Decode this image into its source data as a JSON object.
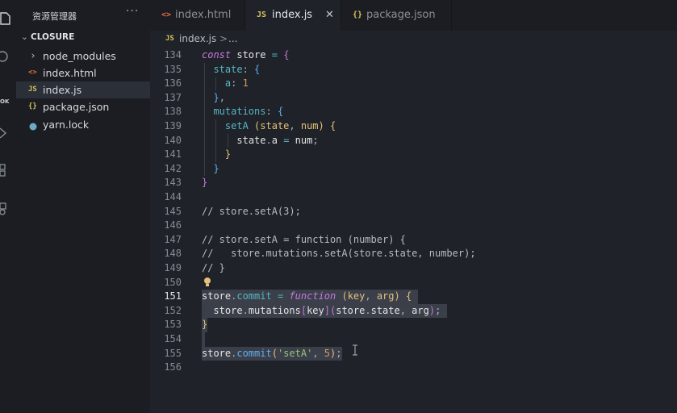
{
  "sidebar": {
    "title": "资源管理器",
    "more_label": "···",
    "root_label": "CLOSURE",
    "items": [
      {
        "label": "node_modules",
        "icon": "folder-chevron-icon",
        "active": false
      },
      {
        "label": "index.html",
        "icon": "html-file-icon",
        "active": false
      },
      {
        "label": "index.js",
        "icon": "js-file-icon",
        "active": true
      },
      {
        "label": "package.json",
        "icon": "json-file-icon",
        "active": false
      },
      {
        "label": "yarn.lock",
        "icon": "yarn-file-icon",
        "active": false
      }
    ],
    "activity_badge": "OK"
  },
  "tabs": [
    {
      "label": "index.html",
      "icon": "html-file-icon",
      "active": false
    },
    {
      "label": "index.js",
      "icon": "js-file-icon",
      "active": true,
      "close": "✕"
    },
    {
      "label": "package.json",
      "icon": "json-file-icon",
      "active": false
    }
  ],
  "breadcrumb": {
    "file_icon": "JS",
    "file": "index.js",
    "separator": ">",
    "rest": "..."
  },
  "icon_glyphs": {
    "html": "<>",
    "js": "JS",
    "json": "{}",
    "chevron": "⌄",
    "chevron_right": "›"
  },
  "colors": {
    "background": "#1f2228",
    "sidebar": "#1b1d22",
    "selection": "#3a3f49",
    "keyword": "#c678dd",
    "property": "#56b6c2",
    "number": "#d19a66",
    "string": "#98c379",
    "function": "#61afef",
    "param": "#e5c07b"
  },
  "editor": {
    "current_line": 151,
    "lines": [
      {
        "n": 134,
        "indent": 0,
        "tokens": [
          [
            "kw",
            "const"
          ],
          [
            "pu",
            " "
          ],
          [
            "id",
            "store"
          ],
          [
            "pu",
            " "
          ],
          [
            "op",
            "="
          ],
          [
            "pu",
            " "
          ],
          [
            "b1",
            "{"
          ]
        ]
      },
      {
        "n": 135,
        "indent": 1,
        "tokens": [
          [
            "prop",
            "state"
          ],
          [
            "pu",
            ": "
          ],
          [
            "b2",
            "{"
          ]
        ]
      },
      {
        "n": 136,
        "indent": 2,
        "tokens": [
          [
            "prop",
            "a"
          ],
          [
            "pu",
            ": "
          ],
          [
            "num",
            "1"
          ]
        ]
      },
      {
        "n": 137,
        "indent": 1,
        "tokens": [
          [
            "b2",
            "}"
          ],
          [
            "pu",
            ","
          ]
        ]
      },
      {
        "n": 138,
        "indent": 1,
        "tokens": [
          [
            "prop",
            "mutations"
          ],
          [
            "pu",
            ": "
          ],
          [
            "b2",
            "{"
          ]
        ]
      },
      {
        "n": 139,
        "indent": 2,
        "tokens": [
          [
            "prop",
            "setA"
          ],
          [
            "pu",
            " "
          ],
          [
            "b3",
            "("
          ],
          [
            "param",
            "state"
          ],
          [
            "pu",
            ", "
          ],
          [
            "param",
            "num"
          ],
          [
            "b3",
            ")"
          ],
          [
            "pu",
            " "
          ],
          [
            "b3",
            "{"
          ]
        ]
      },
      {
        "n": 140,
        "indent": 3,
        "tokens": [
          [
            "id",
            "state"
          ],
          [
            "pu",
            "."
          ],
          [
            "id",
            "a"
          ],
          [
            "pu",
            " "
          ],
          [
            "op",
            "="
          ],
          [
            "pu",
            " "
          ],
          [
            "id",
            "num"
          ],
          [
            "pu",
            ";"
          ]
        ]
      },
      {
        "n": 141,
        "indent": 2,
        "tokens": [
          [
            "b3",
            "}"
          ]
        ]
      },
      {
        "n": 142,
        "indent": 1,
        "tokens": [
          [
            "b2",
            "}"
          ]
        ]
      },
      {
        "n": 143,
        "indent": 0,
        "tokens": [
          [
            "b1",
            "}"
          ]
        ]
      },
      {
        "n": 144,
        "indent": 0,
        "tokens": []
      },
      {
        "n": 145,
        "indent": 0,
        "tokens": [
          [
            "cm",
            "// store.setA(3);"
          ]
        ]
      },
      {
        "n": 146,
        "indent": 0,
        "tokens": []
      },
      {
        "n": 147,
        "indent": 0,
        "tokens": [
          [
            "cm",
            "// store.setA = function (number) {"
          ]
        ]
      },
      {
        "n": 148,
        "indent": 0,
        "tokens": [
          [
            "cm",
            "//   store.mutations.setA(store.state, number);"
          ]
        ]
      },
      {
        "n": 149,
        "indent": 0,
        "tokens": [
          [
            "cm",
            "// }"
          ]
        ]
      },
      {
        "n": 150,
        "indent": 0,
        "tokens": [],
        "bulb": true
      },
      {
        "n": 151,
        "indent": 0,
        "tokens": [
          [
            "id",
            "store"
          ],
          [
            "pu",
            "."
          ],
          [
            "prop",
            "commit"
          ],
          [
            "pu",
            " "
          ],
          [
            "op",
            "="
          ],
          [
            "pu",
            " "
          ],
          [
            "kw",
            "function"
          ],
          [
            "pu",
            " "
          ],
          [
            "b3",
            "("
          ],
          [
            "param",
            "key"
          ],
          [
            "pu",
            ", "
          ],
          [
            "param",
            "arg"
          ],
          [
            "b3",
            ")"
          ],
          [
            "pu",
            " "
          ],
          [
            "b3",
            "{"
          ]
        ],
        "sel": 37
      },
      {
        "n": 152,
        "indent": 1,
        "tokens": [
          [
            "id",
            "store"
          ],
          [
            "pu",
            "."
          ],
          [
            "id",
            "mutations"
          ],
          [
            "b1",
            "["
          ],
          [
            "id",
            "key"
          ],
          [
            "b1",
            "]"
          ],
          [
            "b1",
            "("
          ],
          [
            "id",
            "store"
          ],
          [
            "pu",
            "."
          ],
          [
            "id",
            "state"
          ],
          [
            "pu",
            ", "
          ],
          [
            "id",
            "arg"
          ],
          [
            "b1",
            ")"
          ],
          [
            "pu",
            ";"
          ]
        ],
        "sel": 42
      },
      {
        "n": 153,
        "indent": 0,
        "tokens": [
          [
            "b3",
            "}"
          ]
        ],
        "sel": 1
      },
      {
        "n": 154,
        "indent": 0,
        "tokens": [],
        "sel": 0.5
      },
      {
        "n": 155,
        "indent": 0,
        "tokens": [
          [
            "id",
            "store"
          ],
          [
            "pu",
            "."
          ],
          [
            "fn",
            "commit"
          ],
          [
            "b3",
            "("
          ],
          [
            "str",
            "'setA'"
          ],
          [
            "pu",
            ", "
          ],
          [
            "num",
            "5"
          ],
          [
            "b3",
            ")"
          ],
          [
            "pu",
            ";"
          ]
        ],
        "sel": 24
      },
      {
        "n": 156,
        "indent": 0,
        "tokens": []
      }
    ]
  }
}
